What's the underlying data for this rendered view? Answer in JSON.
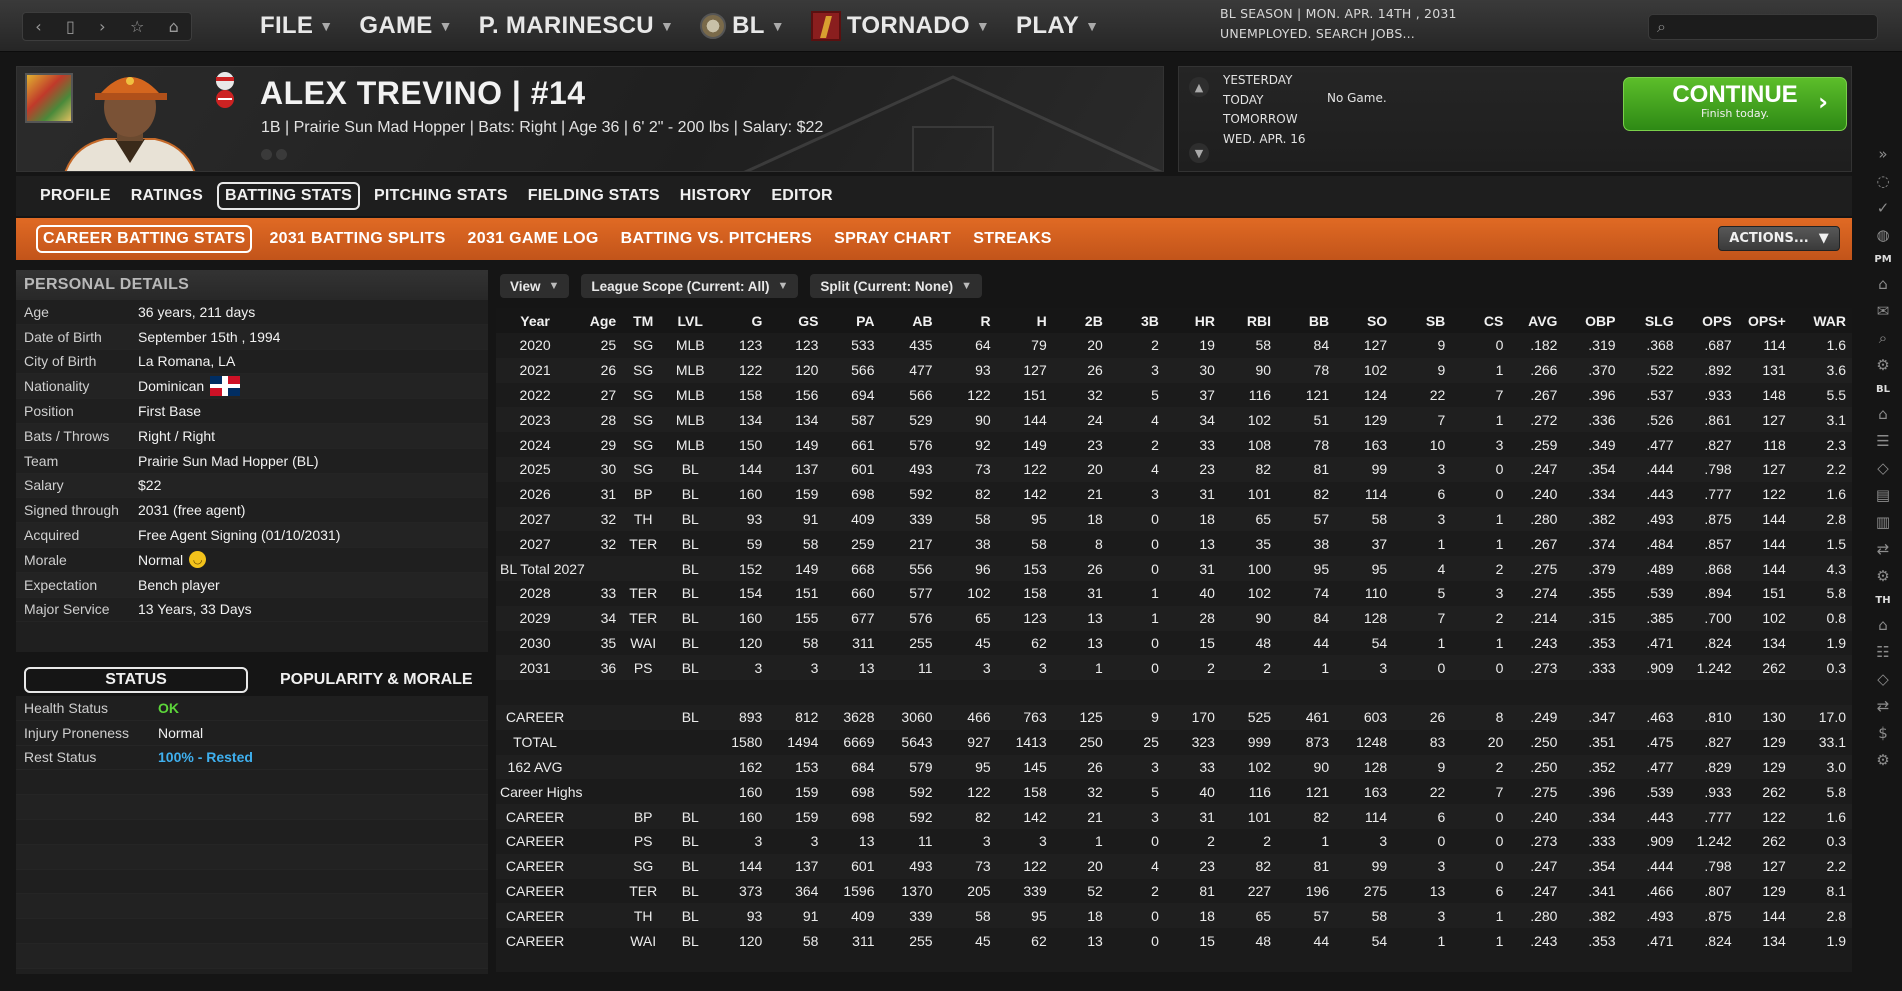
{
  "topbar": {
    "nav": [
      "‹",
      "▯",
      "›",
      "☆",
      "⌂"
    ],
    "menu": [
      {
        "label": "FILE"
      },
      {
        "label": "GAME"
      },
      {
        "label": "P. MARINESCU"
      },
      {
        "label": "BL"
      },
      {
        "label": "TORNADO"
      },
      {
        "label": "PLAY"
      }
    ],
    "status_line1": "BL SEASON  |  MON. APR. 14TH , 2031",
    "status_line2": "UNEMPLOYED. SEARCH JOBS...",
    "search_placeholder": ""
  },
  "player": {
    "name": "ALEX TREVINO  |  #14",
    "subtitle": "1B | Prairie Sun Mad Hopper  |  Bats: Right  |  Age 36  |  6' 2\" - 200 lbs  |  Salary: $22"
  },
  "schedule": {
    "days": [
      "YESTERDAY",
      "TODAY",
      "TOMORROW",
      "WED. APR. 16"
    ],
    "today_game": "No Game.",
    "continue_label": "CONTINUE",
    "continue_sub": "Finish today."
  },
  "tabs": [
    "PROFILE",
    "RATINGS",
    "BATTING STATS",
    "PITCHING STATS",
    "FIELDING STATS",
    "HISTORY",
    "EDITOR"
  ],
  "active_tab": "BATTING STATS",
  "subtabs": [
    "CAREER BATTING STATS",
    "2031 BATTING SPLITS",
    "2031 GAME LOG",
    "BATTING VS. PITCHERS",
    "SPRAY CHART",
    "STREAKS"
  ],
  "active_subtab": "CAREER BATTING STATS",
  "actions_label": "ACTIONS...",
  "personal": {
    "title": "PERSONAL DETAILS",
    "rows": [
      {
        "k": "Age",
        "v": "36 years, 211 days"
      },
      {
        "k": "Date of Birth",
        "v": "September 15th , 1994"
      },
      {
        "k": "City of Birth",
        "v": "La Romana, LA"
      },
      {
        "k": "Nationality",
        "v": "Dominican"
      },
      {
        "k": "Position",
        "v": "First Base"
      },
      {
        "k": "Bats / Throws",
        "v": "Right / Right"
      },
      {
        "k": "Team",
        "v": "Prairie Sun Mad Hopper (BL)"
      },
      {
        "k": "Salary",
        "v": "$22"
      },
      {
        "k": "Signed through",
        "v": "2031 (free agent)"
      },
      {
        "k": "Acquired",
        "v": "Free Agent Signing (01/10/2031)"
      },
      {
        "k": "Morale",
        "v": "Normal"
      },
      {
        "k": "Expectation",
        "v": "Bench player"
      },
      {
        "k": "Major Service",
        "v": "13 Years, 33 Days"
      }
    ]
  },
  "status": {
    "tab_active": "STATUS",
    "tab_other": "POPULARITY & MORALE",
    "rows": [
      {
        "k": "Health Status",
        "v": "OK"
      },
      {
        "k": "Injury Proneness",
        "v": "Normal"
      },
      {
        "k": "Rest Status",
        "v": "100% - Rested"
      }
    ]
  },
  "filters": {
    "view": "View",
    "scope": "League Scope (Current: All)",
    "split": "Split  (Current: None)"
  },
  "colors": {
    "accent_orange": "#d9621f",
    "continue_green": "#3ea21d",
    "ok_green": "#5cd63a",
    "rest_blue": "#3fb0ef"
  },
  "table": {
    "columns": [
      "Year",
      "Age",
      "TM",
      "LVL",
      "G",
      "GS",
      "PA",
      "AB",
      "R",
      "H",
      "2B",
      "3B",
      "HR",
      "RBI",
      "BB",
      "SO",
      "SB",
      "CS",
      "AVG",
      "OBP",
      "SLG",
      "OPS",
      "OPS+",
      "WAR"
    ],
    "rows": [
      [
        "2020",
        "25",
        "SG",
        "MLB",
        "123",
        "123",
        "533",
        "435",
        "64",
        "79",
        "20",
        "2",
        "19",
        "58",
        "84",
        "127",
        "9",
        "0",
        ".182",
        ".319",
        ".368",
        ".687",
        "114",
        "1.6"
      ],
      [
        "2021",
        "26",
        "SG",
        "MLB",
        "122",
        "120",
        "566",
        "477",
        "93",
        "127",
        "26",
        "3",
        "30",
        "90",
        "78",
        "102",
        "9",
        "1",
        ".266",
        ".370",
        ".522",
        ".892",
        "131",
        "3.6"
      ],
      [
        "2022",
        "27",
        "SG",
        "MLB",
        "158",
        "156",
        "694",
        "566",
        "122",
        "151",
        "32",
        "5",
        "37",
        "116",
        "121",
        "124",
        "22",
        "7",
        ".267",
        ".396",
        ".537",
        ".933",
        "148",
        "5.5"
      ],
      [
        "2023",
        "28",
        "SG",
        "MLB",
        "134",
        "134",
        "587",
        "529",
        "90",
        "144",
        "24",
        "4",
        "34",
        "102",
        "51",
        "129",
        "7",
        "1",
        ".272",
        ".336",
        ".526",
        ".861",
        "127",
        "3.1"
      ],
      [
        "2024",
        "29",
        "SG",
        "MLB",
        "150",
        "149",
        "661",
        "576",
        "92",
        "149",
        "23",
        "2",
        "33",
        "108",
        "78",
        "163",
        "10",
        "3",
        ".259",
        ".349",
        ".477",
        ".827",
        "118",
        "2.3"
      ],
      [
        "2025",
        "30",
        "SG",
        "BL",
        "144",
        "137",
        "601",
        "493",
        "73",
        "122",
        "20",
        "4",
        "23",
        "82",
        "81",
        "99",
        "3",
        "0",
        ".247",
        ".354",
        ".444",
        ".798",
        "127",
        "2.2"
      ],
      [
        "2026",
        "31",
        "BP",
        "BL",
        "160",
        "159",
        "698",
        "592",
        "82",
        "142",
        "21",
        "3",
        "31",
        "101",
        "82",
        "114",
        "6",
        "0",
        ".240",
        ".334",
        ".443",
        ".777",
        "122",
        "1.6"
      ],
      [
        "2027",
        "32",
        "TH",
        "BL",
        "93",
        "91",
        "409",
        "339",
        "58",
        "95",
        "18",
        "0",
        "18",
        "65",
        "57",
        "58",
        "3",
        "1",
        ".280",
        ".382",
        ".493",
        ".875",
        "144",
        "2.8"
      ],
      [
        "2027",
        "32",
        "TER",
        "BL",
        "59",
        "58",
        "259",
        "217",
        "38",
        "58",
        "8",
        "0",
        "13",
        "35",
        "38",
        "37",
        "1",
        "1",
        ".267",
        ".374",
        ".484",
        ".857",
        "144",
        "1.5"
      ],
      [
        "BL Total 2027",
        "",
        "",
        "BL",
        "152",
        "149",
        "668",
        "556",
        "96",
        "153",
        "26",
        "0",
        "31",
        "100",
        "95",
        "95",
        "4",
        "2",
        ".275",
        ".379",
        ".489",
        ".868",
        "144",
        "4.3"
      ],
      [
        "2028",
        "33",
        "TER",
        "BL",
        "154",
        "151",
        "660",
        "577",
        "102",
        "158",
        "31",
        "1",
        "40",
        "102",
        "74",
        "110",
        "5",
        "3",
        ".274",
        ".355",
        ".539",
        ".894",
        "151",
        "5.8"
      ],
      [
        "2029",
        "34",
        "TER",
        "BL",
        "160",
        "155",
        "677",
        "576",
        "65",
        "123",
        "13",
        "1",
        "28",
        "90",
        "84",
        "128",
        "7",
        "2",
        ".214",
        ".315",
        ".385",
        ".700",
        "102",
        "0.8"
      ],
      [
        "2030",
        "35",
        "WAI",
        "BL",
        "120",
        "58",
        "311",
        "255",
        "45",
        "62",
        "13",
        "0",
        "15",
        "48",
        "44",
        "54",
        "1",
        "1",
        ".243",
        ".353",
        ".471",
        ".824",
        "134",
        "1.9"
      ],
      [
        "2031",
        "36",
        "PS",
        "BL",
        "3",
        "3",
        "13",
        "11",
        "3",
        "3",
        "1",
        "0",
        "2",
        "2",
        "1",
        "3",
        "0",
        "0",
        ".273",
        ".333",
        ".909",
        "1.242",
        "262",
        "0.3"
      ],
      [
        "",
        "",
        "",
        "",
        "",
        "",
        "",
        "",
        "",
        "",
        "",
        "",
        "",
        "",
        "",
        "",
        "",
        "",
        "",
        "",
        "",
        "",
        "",
        ""
      ],
      [
        "CAREER",
        "",
        "",
        "BL",
        "893",
        "812",
        "3628",
        "3060",
        "466",
        "763",
        "125",
        "9",
        "170",
        "525",
        "461",
        "603",
        "26",
        "8",
        ".249",
        ".347",
        ".463",
        ".810",
        "130",
        "17.0"
      ],
      [
        "TOTAL",
        "",
        "",
        "",
        "1580",
        "1494",
        "6669",
        "5643",
        "927",
        "1413",
        "250",
        "25",
        "323",
        "999",
        "873",
        "1248",
        "83",
        "20",
        ".250",
        ".351",
        ".475",
        ".827",
        "129",
        "33.1"
      ],
      [
        "162 AVG",
        "",
        "",
        "",
        "162",
        "153",
        "684",
        "579",
        "95",
        "145",
        "26",
        "3",
        "33",
        "102",
        "90",
        "128",
        "9",
        "2",
        ".250",
        ".352",
        ".477",
        ".829",
        "129",
        "3.0"
      ],
      [
        "Career Highs",
        "",
        "",
        "",
        "160",
        "159",
        "698",
        "592",
        "122",
        "158",
        "32",
        "5",
        "40",
        "116",
        "121",
        "163",
        "22",
        "7",
        ".275",
        ".396",
        ".539",
        ".933",
        "262",
        "5.8"
      ],
      [
        "CAREER",
        "",
        "BP",
        "BL",
        "160",
        "159",
        "698",
        "592",
        "82",
        "142",
        "21",
        "3",
        "31",
        "101",
        "82",
        "114",
        "6",
        "0",
        ".240",
        ".334",
        ".443",
        ".777",
        "122",
        "1.6"
      ],
      [
        "CAREER",
        "",
        "PS",
        "BL",
        "3",
        "3",
        "13",
        "11",
        "3",
        "3",
        "1",
        "0",
        "2",
        "2",
        "1",
        "3",
        "0",
        "0",
        ".273",
        ".333",
        ".909",
        "1.242",
        "262",
        "0.3"
      ],
      [
        "CAREER",
        "",
        "SG",
        "BL",
        "144",
        "137",
        "601",
        "493",
        "73",
        "122",
        "20",
        "4",
        "23",
        "82",
        "81",
        "99",
        "3",
        "0",
        ".247",
        ".354",
        ".444",
        ".798",
        "127",
        "2.2"
      ],
      [
        "CAREER",
        "",
        "TER",
        "BL",
        "373",
        "364",
        "1596",
        "1370",
        "205",
        "339",
        "52",
        "2",
        "81",
        "227",
        "196",
        "275",
        "13",
        "6",
        ".247",
        ".341",
        ".466",
        ".807",
        "129",
        "8.1"
      ],
      [
        "CAREER",
        "",
        "TH",
        "BL",
        "93",
        "91",
        "409",
        "339",
        "58",
        "95",
        "18",
        "0",
        "18",
        "65",
        "57",
        "58",
        "3",
        "1",
        ".280",
        ".382",
        ".493",
        ".875",
        "144",
        "2.8"
      ],
      [
        "CAREER",
        "",
        "WAI",
        "BL",
        "120",
        "58",
        "311",
        "255",
        "45",
        "62",
        "13",
        "0",
        "15",
        "48",
        "44",
        "54",
        "1",
        "1",
        ".243",
        ".353",
        ".471",
        ".824",
        "134",
        "1.9"
      ]
    ]
  },
  "rail": {
    "pm_label": "PM",
    "bl_label": "BL",
    "th_label": "TH"
  }
}
